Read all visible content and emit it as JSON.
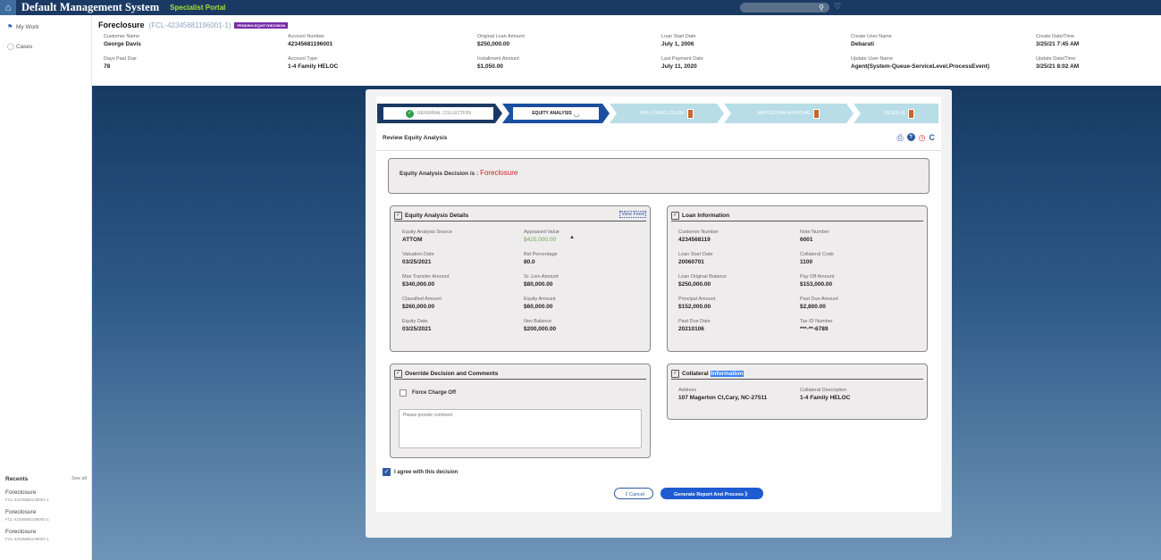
{
  "app": {
    "title": "Default Management System",
    "portal": "Specialist Portal",
    "home_icon": "home-icon",
    "search_icon": "search-icon",
    "bell_icon": "bell-icon"
  },
  "nav": {
    "items": [
      {
        "label": "My Work",
        "icon": "flag-icon"
      },
      {
        "label": "Cases",
        "icon": "cases-icon"
      }
    ],
    "recents_label": "Recents",
    "see_all": "See all",
    "recents": [
      {
        "title": "Foreclosure",
        "sub": "FCL-42345681126001-1"
      },
      {
        "title": "Foreclosure",
        "sub": "FCL-42345681196001-1"
      },
      {
        "title": "Foreclosure",
        "sub": "FCL-42345681196001-1"
      }
    ]
  },
  "case": {
    "title": "Foreclosure",
    "id": "(FCL-42345681196001-1)",
    "status": "PENDING-EQUITYDECISION",
    "fields": [
      {
        "label": "Customer Name",
        "value": "George Davis"
      },
      {
        "label": "Account Number",
        "value": "42345681196001"
      },
      {
        "label": "Original Loan Amount",
        "value": "$250,000.00"
      },
      {
        "label": "Loan Start Date",
        "value": "July 1, 2006"
      },
      {
        "label": "Create User Name",
        "value": "Debarati"
      },
      {
        "label": "Create Date/Time",
        "value": "3/25/21 7:45 AM"
      },
      {
        "label": "Days Past Due",
        "value": "78"
      },
      {
        "label": "Account Type",
        "value": "1-4 Family HELOC"
      },
      {
        "label": "Installment Amount",
        "value": "$1,050.00"
      },
      {
        "label": "Last Payment Date",
        "value": "July 11, 2020"
      },
      {
        "label": "Update User Name",
        "value": "Agent(System-Queue-ServiceLevel.ProcessEvent)"
      },
      {
        "label": "Update Date/Time",
        "value": "3/25/21 8:02 AM"
      }
    ]
  },
  "stepper": {
    "steps": [
      {
        "label": "REFERRAL COLLECTION",
        "state": "done"
      },
      {
        "label": "EQUITY ANALYSIS",
        "state": "current"
      },
      {
        "label": "PRE FORECLOSURE",
        "state": "pending"
      },
      {
        "label": "WRITEDOWN APPROVAL",
        "state": "pending"
      },
      {
        "label": "RESOLVE",
        "state": "pending"
      }
    ],
    "colors": {
      "done": "#1b3a63",
      "current": "#1b4fa0",
      "pending": "#b8dde6",
      "check": "#2e9e4a",
      "hourglass": "#c9672b"
    }
  },
  "review": {
    "title": "Review Equity Analysis",
    "icons": [
      "print-icon",
      "help-icon",
      "clock-icon",
      "refresh-icon"
    ]
  },
  "decision": {
    "label": "Equity Analysis Decision is :",
    "value": "Foreclosure"
  },
  "equity_details": {
    "title": "Equity Analysis Details",
    "view_feed": "View Feed",
    "fields": [
      {
        "label": "Equity Analysis Source",
        "value": "ATTOM"
      },
      {
        "label": "Appraised Value",
        "value": "$425,000.00"
      },
      {
        "label": "Valuation Date",
        "value": "03/25/2021"
      },
      {
        "label": "Bid Percentage",
        "value": "80.0"
      },
      {
        "label": "Max Transfer Amount",
        "value": "$340,000.00"
      },
      {
        "label": "Sr. Lien Amount",
        "value": "$80,000.00"
      },
      {
        "label": "Classified Amount",
        "value": "$260,000.00"
      },
      {
        "label": "Equity Amount",
        "value": "$60,000.00"
      },
      {
        "label": "Equity Date",
        "value": "03/25/2021"
      },
      {
        "label": "Nev Balance",
        "value": "$200,000.00"
      }
    ]
  },
  "loan_info": {
    "title": "Loan Information",
    "fields": [
      {
        "label": "Customer Number",
        "value": "4234568119"
      },
      {
        "label": "Note Number",
        "value": "6001"
      },
      {
        "label": "Loan Start Date",
        "value": "20060701"
      },
      {
        "label": "Collateral Code",
        "value": "1100"
      },
      {
        "label": "Loan Original Balance",
        "value": "$250,000.00"
      },
      {
        "label": "Pay Off Amount",
        "value": "$153,000.00"
      },
      {
        "label": "Principal Amount",
        "value": "$152,000.00"
      },
      {
        "label": "Past Due Amount",
        "value": "$2,800.00"
      },
      {
        "label": "Past Due Date",
        "value": "20210106"
      },
      {
        "label": "Tax ID Number",
        "value": "***-**-6789"
      }
    ]
  },
  "override": {
    "title": "Override Decision and Comments",
    "force_label": "Force Charge Off",
    "comment_placeholder": "Please provide comment"
  },
  "collateral": {
    "title_a": "Collateral",
    "title_b": "Information",
    "fields": [
      {
        "label": "Address",
        "value": "107 Magerton Ct,Cary, NC-27511"
      },
      {
        "label": "Collateral Description",
        "value": "1-4 Family HELOC"
      }
    ]
  },
  "agree_label": "I agree with this decision",
  "buttons": {
    "cancel": "《 Cancel",
    "generate": "Generate Report And Process 》"
  }
}
